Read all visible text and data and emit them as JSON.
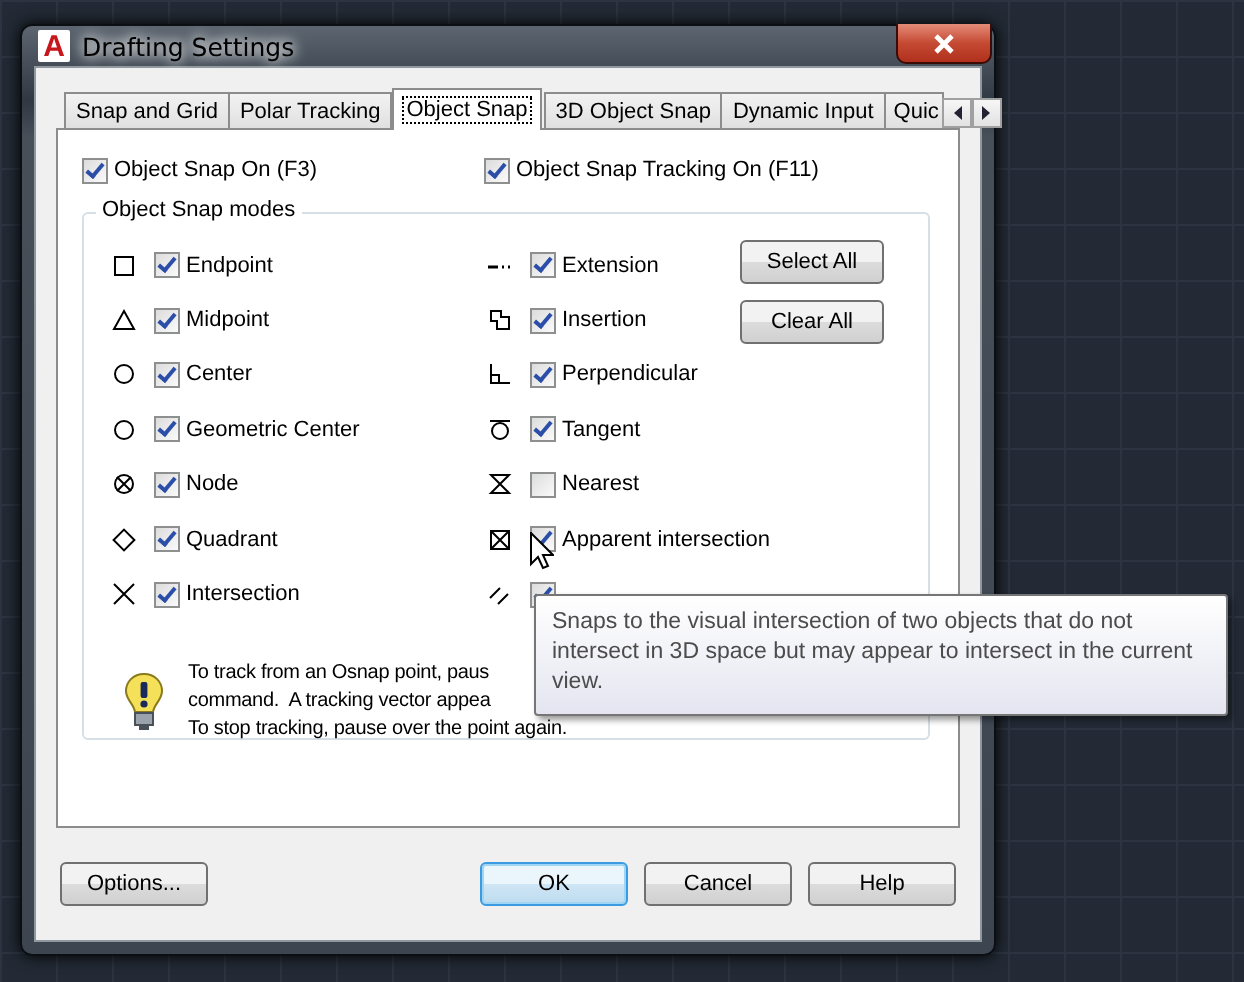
{
  "window": {
    "icon_text": "A",
    "title": "Drafting Settings"
  },
  "tabs": [
    {
      "label": "Snap and Grid",
      "selected": false
    },
    {
      "label": "Polar Tracking",
      "selected": false
    },
    {
      "label": "Object Snap",
      "selected": true
    },
    {
      "label": "3D Object Snap",
      "selected": false
    },
    {
      "label": "Dynamic Input",
      "selected": false
    },
    {
      "label": "Quic",
      "selected": false
    }
  ],
  "toggles": [
    {
      "label": "Object Snap On (F3)",
      "checked": true
    },
    {
      "label": "Object Snap Tracking On (F11)",
      "checked": true
    }
  ],
  "group": {
    "title": "Object Snap modes",
    "modes": [
      {
        "label": "Endpoint",
        "checked": true
      },
      {
        "label": "Extension",
        "checked": true
      },
      {
        "label": "Midpoint",
        "checked": true
      },
      {
        "label": "Insertion",
        "checked": true
      },
      {
        "label": "Center",
        "checked": true
      },
      {
        "label": "Perpendicular",
        "checked": true
      },
      {
        "label": "Geometric Center",
        "checked": true
      },
      {
        "label": "Tangent",
        "checked": true
      },
      {
        "label": "Node",
        "checked": true
      },
      {
        "label": "Nearest",
        "checked": false
      },
      {
        "label": "Quadrant",
        "checked": true
      },
      {
        "label": "Apparent intersection",
        "checked": true
      },
      {
        "label": "Intersection",
        "checked": true
      },
      {
        "checked": true
      }
    ],
    "buttons": [
      "Select All",
      "Clear All"
    ],
    "hint": [
      "To track from an Osnap point, paus",
      "command.  A tracking vector appea",
      "To stop tracking, pause over the point again."
    ]
  },
  "tooltip": {
    "text": "Snaps to the visual intersection of two objects that do not intersect in 3D space but may appear to intersect in the current view."
  },
  "footer_buttons": [
    {
      "label": "Options...",
      "default": false
    },
    {
      "label": "OK",
      "default": true
    },
    {
      "label": "Cancel",
      "default": false
    },
    {
      "label": "Help",
      "default": false
    }
  ]
}
